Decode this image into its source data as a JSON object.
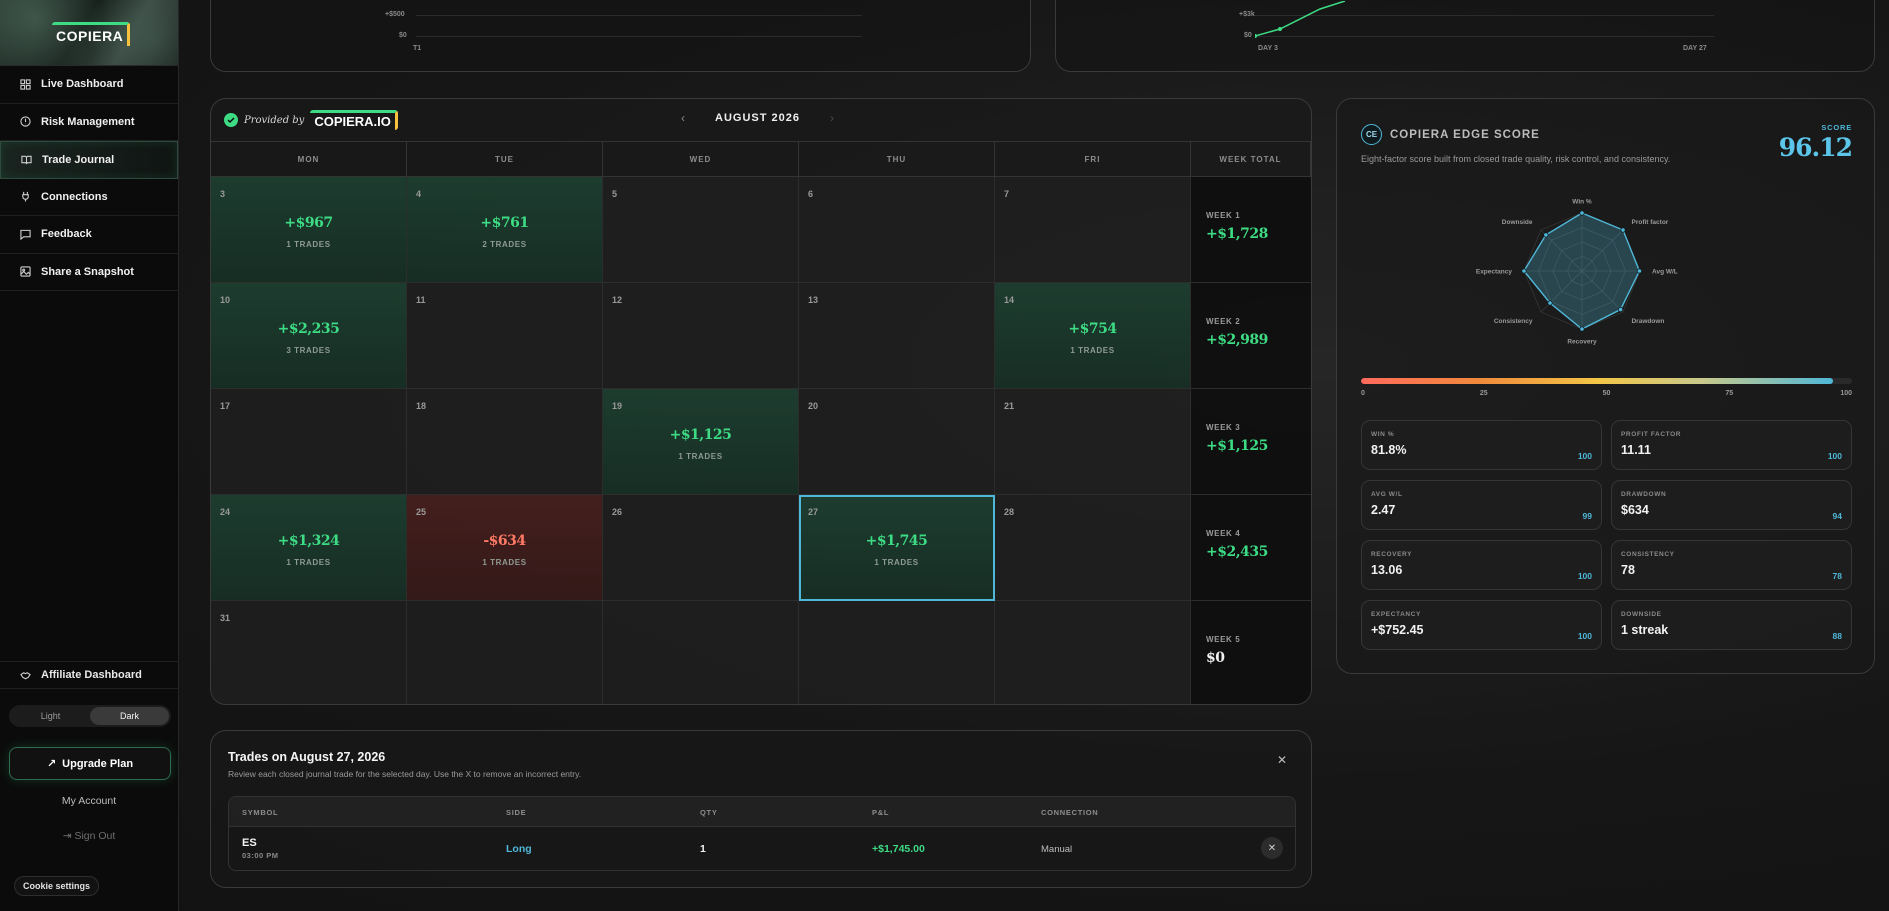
{
  "brand": {
    "logo_text": "COPIERA"
  },
  "sidebar": {
    "items": [
      {
        "label": "Live Dashboard",
        "icon": "grid-icon"
      },
      {
        "label": "Risk Management",
        "icon": "shield-icon"
      },
      {
        "label": "Trade Journal",
        "icon": "book-icon"
      },
      {
        "label": "Connections",
        "icon": "plug-icon"
      },
      {
        "label": "Feedback",
        "icon": "chat-icon"
      },
      {
        "label": "Share a Snapshot",
        "icon": "image-icon"
      }
    ],
    "active_item": "Trade Journal",
    "affiliate_label": "Affiliate Dashboard",
    "theme": {
      "light_label": "Light",
      "dark_label": "Dark",
      "selected": "Dark"
    },
    "upgrade_label": "Upgrade Plan",
    "account_label": "My Account",
    "signout_label": "Sign Out",
    "cookie_label": "Cookie settings"
  },
  "top_charts": {
    "left": {
      "y_ticks": [
        "+$500",
        "$0"
      ],
      "x_ticks": [
        "T1"
      ]
    },
    "right": {
      "y_ticks": [
        "+$3k",
        "$0"
      ],
      "x_ticks": [
        "DAY 3",
        "DAY 27"
      ]
    }
  },
  "calendar": {
    "provided_by": "Provided by",
    "provider_badge": "COPIERA.IO",
    "month": "AUGUST 2026",
    "columns": [
      "MON",
      "TUE",
      "WED",
      "THU",
      "FRI",
      "WEEK TOTAL"
    ],
    "weeks": [
      {
        "days": [
          {
            "num": "3",
            "pnl": "+$967",
            "trades": "1 TRADES",
            "status": "win"
          },
          {
            "num": "4",
            "pnl": "+$761",
            "trades": "2 TRADES",
            "status": "win"
          },
          {
            "num": "5",
            "pnl": "",
            "trades": "",
            "status": "none"
          },
          {
            "num": "6",
            "pnl": "",
            "trades": "",
            "status": "none"
          },
          {
            "num": "7",
            "pnl": "",
            "trades": "",
            "status": "none"
          }
        ],
        "label": "WEEK 1",
        "total": "+$1,728"
      },
      {
        "days": [
          {
            "num": "10",
            "pnl": "+$2,235",
            "trades": "3 TRADES",
            "status": "win"
          },
          {
            "num": "11",
            "pnl": "",
            "trades": "",
            "status": "none"
          },
          {
            "num": "12",
            "pnl": "",
            "trades": "",
            "status": "none"
          },
          {
            "num": "13",
            "pnl": "",
            "trades": "",
            "status": "none"
          },
          {
            "num": "14",
            "pnl": "+$754",
            "trades": "1 TRADES",
            "status": "win"
          }
        ],
        "label": "WEEK 2",
        "total": "+$2,989"
      },
      {
        "days": [
          {
            "num": "17",
            "pnl": "",
            "trades": "",
            "status": "none"
          },
          {
            "num": "18",
            "pnl": "",
            "trades": "",
            "status": "none"
          },
          {
            "num": "19",
            "pnl": "+$1,125",
            "trades": "1 TRADES",
            "status": "win"
          },
          {
            "num": "20",
            "pnl": "",
            "trades": "",
            "status": "none"
          },
          {
            "num": "21",
            "pnl": "",
            "trades": "",
            "status": "none"
          }
        ],
        "label": "WEEK 3",
        "total": "+$1,125"
      },
      {
        "days": [
          {
            "num": "24",
            "pnl": "+$1,324",
            "trades": "1 TRADES",
            "status": "win"
          },
          {
            "num": "25",
            "pnl": "-$634",
            "trades": "1 TRADES",
            "status": "loss"
          },
          {
            "num": "26",
            "pnl": "",
            "trades": "",
            "status": "none"
          },
          {
            "num": "27",
            "pnl": "+$1,745",
            "trades": "1 TRADES",
            "status": "win",
            "selected": true
          },
          {
            "num": "28",
            "pnl": "",
            "trades": "",
            "status": "none"
          }
        ],
        "label": "WEEK 4",
        "total": "+$2,435"
      },
      {
        "days": [
          {
            "num": "31",
            "pnl": "",
            "trades": "",
            "status": "none"
          },
          {
            "num": "",
            "pnl": "",
            "trades": "",
            "status": "none"
          },
          {
            "num": "",
            "pnl": "",
            "trades": "",
            "status": "none"
          },
          {
            "num": "",
            "pnl": "",
            "trades": "",
            "status": "none"
          },
          {
            "num": "",
            "pnl": "",
            "trades": "",
            "status": "none"
          }
        ],
        "label": "WEEK 5",
        "total": "$0"
      }
    ]
  },
  "edge_score": {
    "badge": "CE",
    "title": "COPIERA EDGE SCORE",
    "subtitle": "Eight-factor score built from closed trade quality, risk control, and consistency.",
    "score_label": "SCORE",
    "score": "96.12",
    "score_value": 96.12,
    "radar_axes": [
      "Win %",
      "Profit factor",
      "Avg W/L",
      "Drawdown",
      "Recovery",
      "Consistency",
      "Expectancy",
      "Downside"
    ],
    "radar_values": [
      100,
      100,
      99,
      94,
      100,
      78,
      100,
      88
    ],
    "scale_ticks": [
      "0",
      "25",
      "50",
      "75",
      "100"
    ],
    "metrics": [
      {
        "label": "WIN %",
        "value": "81.8%",
        "score": "100"
      },
      {
        "label": "PROFIT FACTOR",
        "value": "11.11",
        "score": "100"
      },
      {
        "label": "AVG W/L",
        "value": "2.47",
        "score": "99"
      },
      {
        "label": "DRAWDOWN",
        "value": "$634",
        "score": "94"
      },
      {
        "label": "RECOVERY",
        "value": "13.06",
        "score": "100"
      },
      {
        "label": "CONSISTENCY",
        "value": "78",
        "score": "78"
      },
      {
        "label": "EXPECTANCY",
        "value": "+$752.45",
        "score": "100"
      },
      {
        "label": "DOWNSIDE",
        "value": "1 streak",
        "score": "88"
      }
    ]
  },
  "trades_panel": {
    "title": "Trades on August 27, 2026",
    "subtitle": "Review each closed journal trade for the selected day. Use the X to remove an incorrect entry.",
    "headers": [
      "SYMBOL",
      "SIDE",
      "QTY",
      "P&L",
      "CONNECTION"
    ],
    "rows": [
      {
        "symbol": "ES",
        "time": "03:00 PM",
        "side": "Long",
        "qty": "1",
        "pnl": "+$1,745.00",
        "connection": "Manual"
      }
    ]
  },
  "colors": {
    "accent_green": "#3ddc84",
    "accent_blue": "#4fb7d8",
    "loss_red": "#ff7a64",
    "brand_yellow": "#f6c23e"
  }
}
